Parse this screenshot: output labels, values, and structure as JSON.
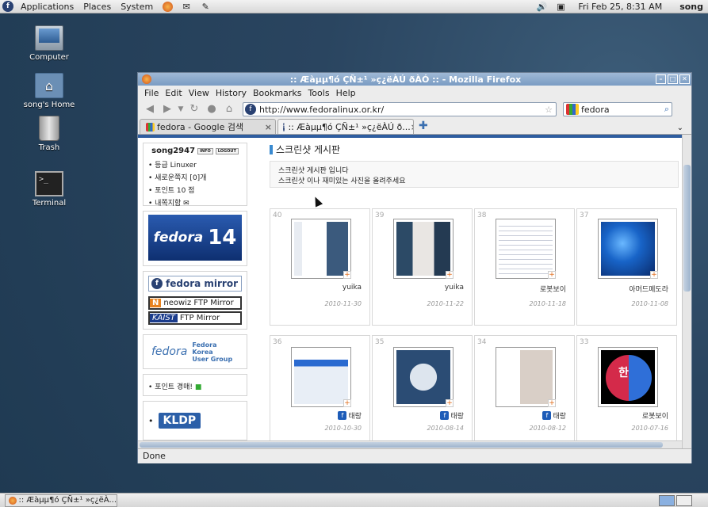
{
  "top_panel": {
    "menus": [
      "Applications",
      "Places",
      "System"
    ],
    "clock": "Fri Feb 25,  8:31 AM",
    "user": "song"
  },
  "desktop": {
    "icons": [
      {
        "label": "Computer"
      },
      {
        "label": "song's Home"
      },
      {
        "label": "Trash"
      },
      {
        "label": "Terminal"
      }
    ]
  },
  "window": {
    "title": ":: Æàµµ¶ó ÇÑ±¹ »ç¿ëÀÚ  ðÀÓ :: - Mozilla Firefox",
    "menubar": [
      "File",
      "Edit",
      "View",
      "History",
      "Bookmarks",
      "Tools",
      "Help"
    ],
    "url": "http://www.fedoralinux.or.kr/",
    "search_value": "fedora",
    "tabs": [
      {
        "label": "fedora - Google 검색",
        "active": false
      },
      {
        "label": ":: Æàµµ¶ó ÇÑ±¹ »ç¿ëÀÚ  ð...",
        "active": true
      }
    ],
    "status": "Done"
  },
  "sidebar": {
    "username": "song2947",
    "info_btn": "INFO",
    "logout_btn": "LOGOUT",
    "items": [
      "등급 Linuxer",
      "새로운쪽지 [0]개",
      "포인트 10 점",
      "내쪽지함"
    ],
    "fedora14": {
      "word": "fedora",
      "num": "14"
    },
    "mirror_title": "fedora mirror",
    "ftp": [
      {
        "badge": "N",
        "text": "neowiz FTP Mirror"
      },
      {
        "badge": "KAIST",
        "text": "FTP Mirror"
      }
    ],
    "kug": {
      "logo": "fedora",
      "line1": "Fedora",
      "line2": "Korea",
      "line3": "User Group"
    },
    "point_auction": "포인트 경매!",
    "kldp": "KLDP"
  },
  "board": {
    "title": "스크린샷 게시판",
    "desc1": "스크린샷 게시판 입니다",
    "desc2": "스크린샷 이나 재미있는 사진을 올려주세요",
    "posts": [
      {
        "num": "40",
        "author": "yuika",
        "date": "2010-11-30"
      },
      {
        "num": "39",
        "author": "yuika",
        "date": "2010-11-22"
      },
      {
        "num": "38",
        "author": "로봇보이",
        "date": "2010-11-18"
      },
      {
        "num": "37",
        "author": "아머드페도라",
        "date": "2010-11-08"
      },
      {
        "num": "36",
        "author": "태랑",
        "date": "2010-10-30"
      },
      {
        "num": "35",
        "author": "태랑",
        "date": "2010-08-14"
      },
      {
        "num": "34",
        "author": "태랑",
        "date": "2010-08-12"
      },
      {
        "num": "33",
        "author": "로봇보이",
        "date": "2010-07-16"
      }
    ],
    "kor_glyph": "한"
  },
  "taskbar": {
    "task_label": ":: Æàµµ¶ó ÇÑ±¹ »ç¿ëÀ..."
  }
}
